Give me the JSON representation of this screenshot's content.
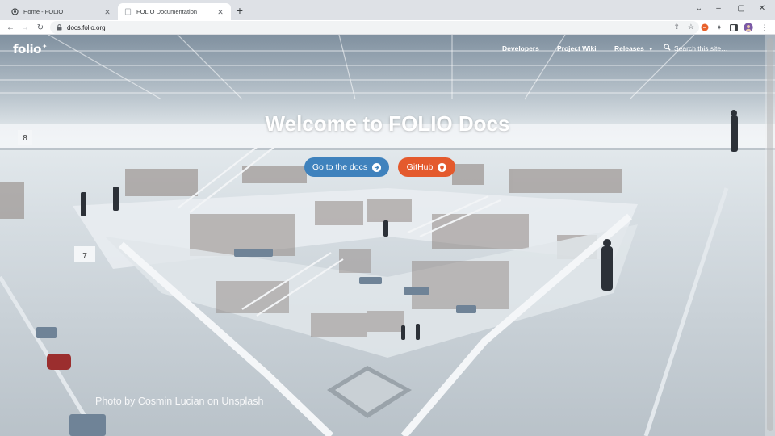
{
  "browser": {
    "tabs": [
      {
        "title": "Home - FOLIO",
        "active": false
      },
      {
        "title": "FOLIO Documentation",
        "active": true
      }
    ],
    "new_tab_label": "+",
    "url": "docs.folio.org",
    "window_controls": {
      "minimize": "–",
      "maximize": "▢",
      "close": "✕"
    }
  },
  "site": {
    "logo_text": "folio",
    "nav": {
      "developers": "Developers",
      "project_wiki": "Project Wiki",
      "releases": "Releases",
      "search_placeholder": "Search this site…"
    },
    "hero": {
      "title": "Welcome to FOLIO Docs",
      "primary_button": "Go to the docs",
      "secondary_button": "GitHub",
      "photo_credit": "Photo by Cosmin Lucian on Unsplash"
    }
  },
  "colors": {
    "primary_button": "#3f82bd",
    "github_button": "#e45a2d",
    "chrome_tabstrip": "#dee1e6"
  }
}
